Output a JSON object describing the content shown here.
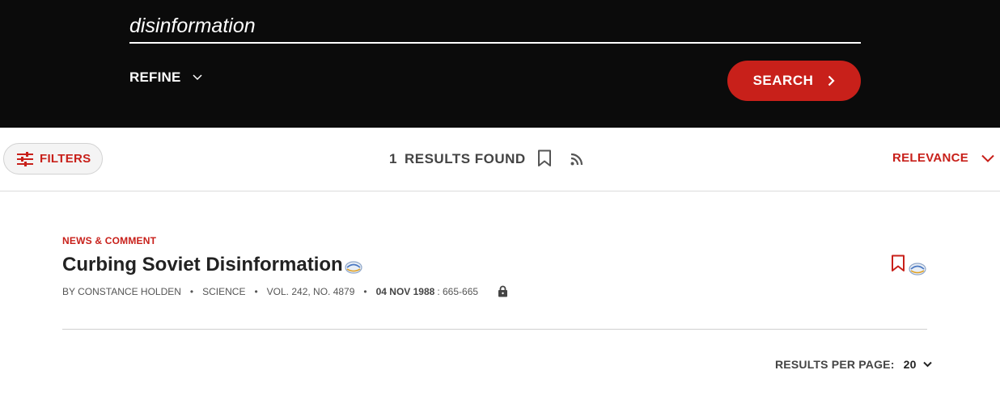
{
  "search": {
    "query": "disinformation",
    "refine_label": "REFINE",
    "button_label": "SEARCH"
  },
  "toolbar": {
    "filters_label": "FILTERS",
    "results_count": "1",
    "results_label": "RESULTS FOUND",
    "sort_label": "RELEVANCE"
  },
  "results": [
    {
      "type": "NEWS & COMMENT",
      "title": "Curbing Soviet Disinformation",
      "author": "BY CONSTANCE HOLDEN",
      "journal": "SCIENCE",
      "volume": "VOL. 242, NO. 4879",
      "date": "04 NOV 1988",
      "pages": ": 665-665"
    }
  ],
  "pagination": {
    "per_page_label": "RESULTS PER PAGE:",
    "per_page_value": "20"
  },
  "colors": {
    "accent": "#c8201a",
    "header_bg": "#0b0b0b"
  },
  "icons": [
    "chevron-down-icon",
    "chevron-right-icon",
    "sliders-icon",
    "bookmark-icon",
    "rss-icon",
    "lock-icon",
    "altmetric-icon"
  ]
}
